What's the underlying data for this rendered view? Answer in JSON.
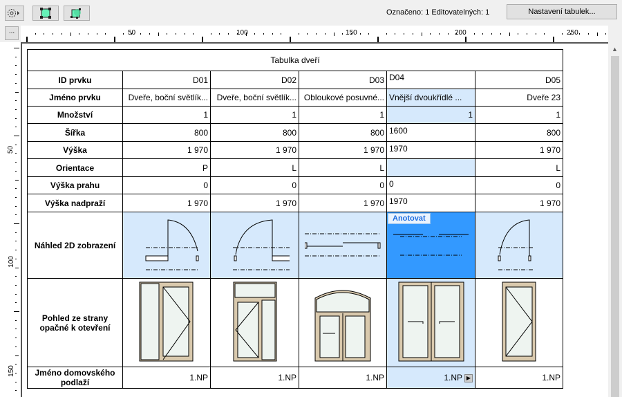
{
  "toolbar": {
    "settings_icon": "gear-icon",
    "select_icon": "select-element-icon",
    "select3d_icon": "select-3d-icon",
    "status": "Označeno: 1  Editovatelných: 1",
    "settings_button": "Nastavení tabulek...",
    "more_button": "..."
  },
  "ruler": {
    "top": [
      "50",
      "100",
      "150",
      "200",
      "250"
    ],
    "left": [
      "50",
      "100",
      "150"
    ]
  },
  "table": {
    "title": "Tabulka dveří",
    "rows": [
      {
        "label": "ID prvku",
        "values": [
          "D01",
          "D02",
          "D03",
          "D04",
          "D05"
        ]
      },
      {
        "label": "Jméno prvku",
        "values": [
          "Dveře, boční světlík...",
          "Dveře, boční světlík...",
          "Obloukové posuvné...",
          "Vnější dvoukřídlé ...",
          "Dveře 23"
        ]
      },
      {
        "label": "Množství",
        "values": [
          "1",
          "1",
          "1",
          "1",
          "1"
        ]
      },
      {
        "label": "Šířka",
        "values": [
          "800",
          "800",
          "800",
          "1600",
          "800"
        ]
      },
      {
        "label": "Výška",
        "values": [
          "1 970",
          "1 970",
          "1 970",
          "1970",
          "1 970"
        ]
      },
      {
        "label": "Orientace",
        "values": [
          "P",
          "L",
          "L",
          "",
          "L"
        ]
      },
      {
        "label": "Výška prahu",
        "values": [
          "0",
          "0",
          "0",
          "0",
          "0"
        ]
      },
      {
        "label": "Výška nadpraží",
        "values": [
          "1 970",
          "1 970",
          "1 970",
          "1970",
          "1 970"
        ]
      }
    ],
    "preview2d_label": "Náhled 2D zobrazení",
    "annotate_button": "Anotovat",
    "elevation_label": "Pohled ze strany opačné k otevření",
    "story_label": "Jméno domovského podlaží",
    "story_values": [
      "1.NP",
      "1.NP",
      "1.NP",
      "1.NP",
      "1.NP"
    ]
  }
}
